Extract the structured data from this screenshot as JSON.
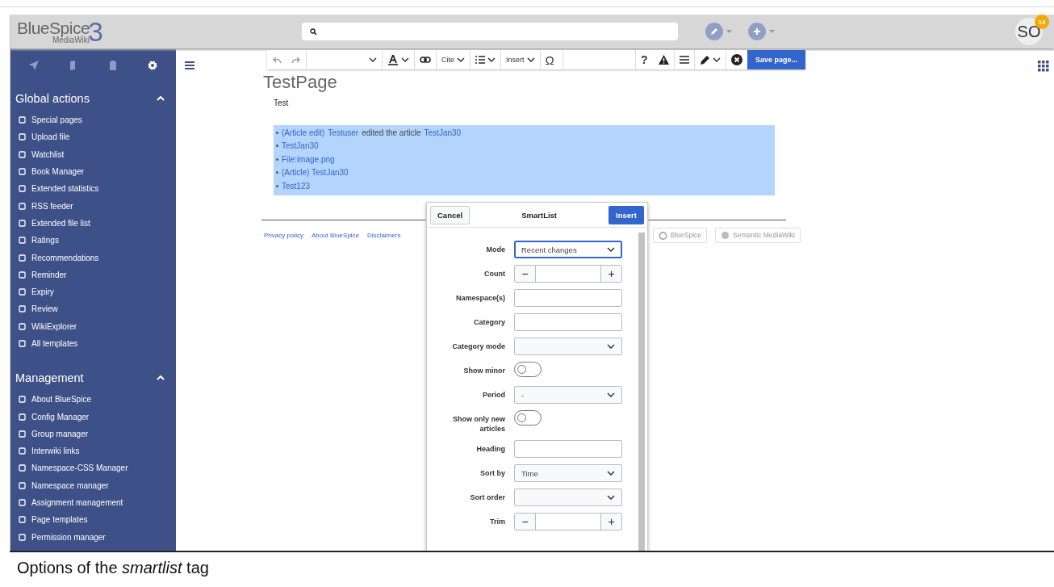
{
  "header": {
    "logo": {
      "name": "BlueSpice",
      "sub": "MediaWiki",
      "mark": "3"
    },
    "avatar": {
      "initials": "SO",
      "badge": "14"
    }
  },
  "sidebar": {
    "tabs": [
      {
        "selected": false
      },
      {
        "selected": false
      },
      {
        "selected": false
      },
      {
        "selected": true
      }
    ],
    "sections": [
      {
        "title": "Global actions",
        "expanded": true,
        "items": [
          "Special pages",
          "Upload file",
          "Watchlist",
          "Book Manager",
          "Extended statistics",
          "RSS feeder",
          "Extended file list",
          "Ratings",
          "Recommendations",
          "Reminder",
          "Expiry",
          "Review",
          "WikiExplorer",
          "All templates"
        ]
      },
      {
        "title": "Management",
        "expanded": true,
        "items": [
          "About BlueSpice",
          "Config Manager",
          "Group manager",
          "Interwiki links",
          "Namespace-CSS Manager",
          "Namespace manager",
          "Assignment management",
          "Page templates",
          "Permission manager"
        ]
      }
    ]
  },
  "toolbar": {
    "cite": "Cite",
    "insert": "Insert",
    "omega": "Ω",
    "help": "?",
    "save": "Save page..."
  },
  "page": {
    "title": "TestPage",
    "text": "Test",
    "list": [
      {
        "parts": [
          {
            "text": "(Article edit)",
            "link": true
          },
          {
            "text": "Testuser",
            "link": true
          },
          {
            "text": "edited the article",
            "link": false
          },
          {
            "text": "TestJan30",
            "link": true
          }
        ]
      },
      {
        "parts": [
          {
            "text": "TestJan30",
            "link": true
          }
        ]
      },
      {
        "parts": [
          {
            "text": "File:image.png",
            "link": true
          }
        ]
      },
      {
        "parts": [
          {
            "text": "(Article) TestJan30",
            "link": true
          }
        ]
      },
      {
        "parts": [
          {
            "text": "Test123",
            "link": true
          }
        ]
      }
    ],
    "footer_links": [
      "Privacy policy",
      "About BlueSpice",
      "Disclaimers"
    ],
    "powered_by": [
      "BlueSpice",
      "Semantic MediaWiki"
    ]
  },
  "dialog": {
    "cancel": "Cancel",
    "title": "SmartList",
    "insert": "Insert",
    "fields": [
      {
        "kind": "select",
        "label": "Mode",
        "value": "Recent changes",
        "focused": true
      },
      {
        "kind": "number",
        "label": "Count",
        "minus": "−",
        "plus": "+"
      },
      {
        "kind": "text",
        "label": "Namespace(s)"
      },
      {
        "kind": "text",
        "label": "Category"
      },
      {
        "kind": "select",
        "label": "Category mode"
      },
      {
        "kind": "toggle",
        "label": "Show minor",
        "on": false
      },
      {
        "kind": "select",
        "label": "Period",
        "value": "-"
      },
      {
        "kind": "toggle",
        "label": "Show only new articles",
        "on": false
      },
      {
        "kind": "text",
        "label": "Heading"
      },
      {
        "kind": "select",
        "label": "Sort by",
        "value": "Time"
      },
      {
        "kind": "select",
        "label": "Sort order"
      },
      {
        "kind": "number",
        "label": "Trim",
        "minus": "−",
        "plus": "+"
      }
    ]
  },
  "caption": "Options of the *smartlist* tag"
}
